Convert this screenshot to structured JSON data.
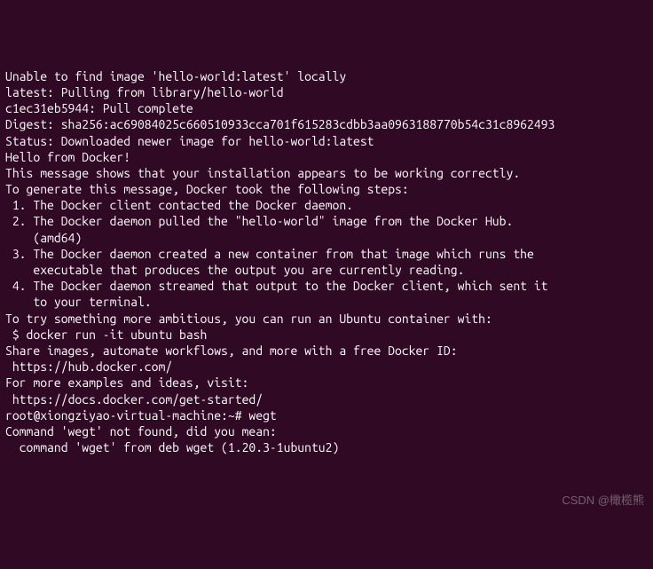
{
  "terminal": {
    "lines": [
      "Unable to find image 'hello-world:latest' locally",
      "latest: Pulling from library/hello-world",
      "c1ec31eb5944: Pull complete",
      "Digest: sha256:ac69084025c660510933cca701f615283cdbb3aa0963188770b54c31c8962493",
      "Status: Downloaded newer image for hello-world:latest",
      "",
      "Hello from Docker!",
      "This message shows that your installation appears to be working correctly.",
      "",
      "To generate this message, Docker took the following steps:",
      " 1. The Docker client contacted the Docker daemon.",
      " 2. The Docker daemon pulled the \"hello-world\" image from the Docker Hub.",
      "    (amd64)",
      " 3. The Docker daemon created a new container from that image which runs the",
      "    executable that produces the output you are currently reading.",
      " 4. The Docker daemon streamed that output to the Docker client, which sent it",
      "    to your terminal.",
      "",
      "To try something more ambitious, you can run an Ubuntu container with:",
      " $ docker run -it ubuntu bash",
      "",
      "Share images, automate workflows, and more with a free Docker ID:",
      " https://hub.docker.com/",
      "",
      "For more examples and ideas, visit:",
      " https://docs.docker.com/get-started/",
      ""
    ],
    "prompt_line": {
      "prompt": "root@xiongziyao-virtual-machine:~# ",
      "command": "wegt"
    },
    "after_prompt": [
      "",
      "Command 'wegt' not found, did you mean:",
      "",
      "  command 'wget' from deb wget (1.20.3-1ubuntu2)"
    ]
  },
  "watermark": "CSDN @橄榄熊"
}
